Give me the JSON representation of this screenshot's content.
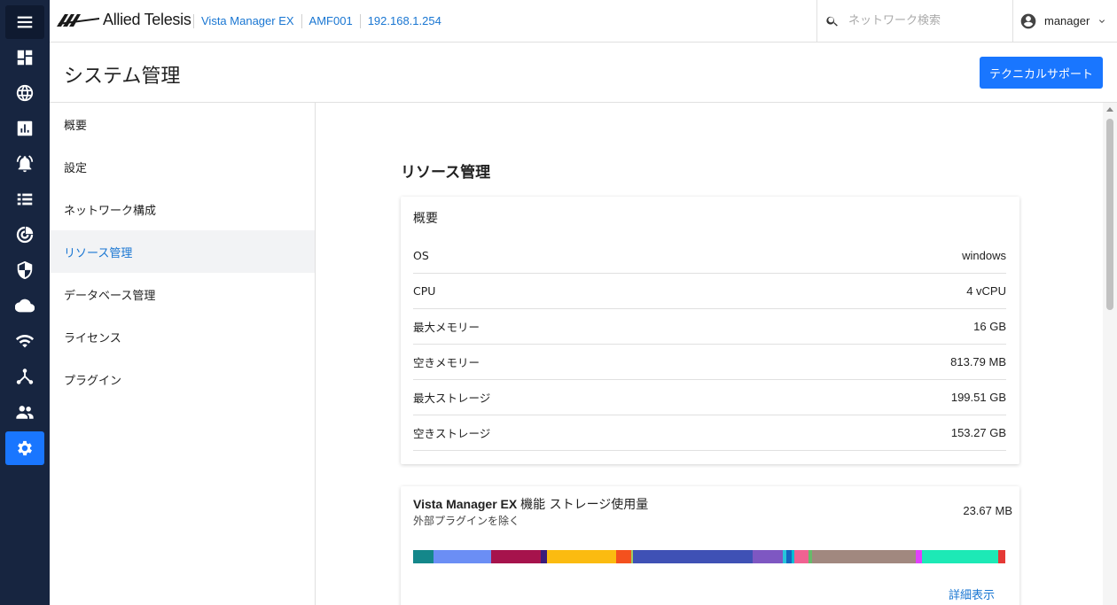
{
  "colors": {
    "rail_bg": "#172540",
    "accent": "#1976ff",
    "link": "#1976d2"
  },
  "rail": {
    "items": [
      {
        "name": "menu-icon"
      },
      {
        "name": "dashboard-icon"
      },
      {
        "name": "globe-icon"
      },
      {
        "name": "analytics-icon"
      },
      {
        "name": "alarm-bell-icon"
      },
      {
        "name": "list-icon"
      },
      {
        "name": "radar-icon"
      },
      {
        "name": "security-shield-icon"
      },
      {
        "name": "cloud-icon"
      },
      {
        "name": "wifi-icon"
      },
      {
        "name": "topology-icon"
      },
      {
        "name": "people-icon"
      },
      {
        "name": "settings-gear-icon",
        "active": true
      }
    ]
  },
  "header": {
    "brand": "Allied Telesis",
    "breadcrumbs": [
      "Vista Manager EX",
      "AMF001",
      "192.168.1.254"
    ],
    "search_placeholder": "ネットワーク検索",
    "user": "manager"
  },
  "page": {
    "title": "システム管理",
    "support_button": "テクニカルサポート"
  },
  "subnav": {
    "items": [
      "概要",
      "設定",
      "ネットワーク構成",
      "リソース管理",
      "データベース管理",
      "ライセンス",
      "プラグイン"
    ],
    "active_index": 3
  },
  "resource": {
    "section_title": "リソース管理",
    "overview": {
      "title": "概要",
      "rows": [
        {
          "label": "OS",
          "value": "windows"
        },
        {
          "label": "CPU",
          "value": "4 vCPU"
        },
        {
          "label": "最大メモリー",
          "value": "16 GB"
        },
        {
          "label": "空きメモリー",
          "value": "813.79 MB"
        },
        {
          "label": "最大ストレージ",
          "value": "199.51 GB"
        },
        {
          "label": "空きストレージ",
          "value": "153.27 GB"
        }
      ]
    },
    "storage": {
      "title_en": "Vista Manager EX",
      "title_jp": "機能 ストレージ使用量",
      "subtitle": "外部プラグインを除く",
      "total": "23.67 MB",
      "segments": [
        {
          "color": "#14878a",
          "share": 3.5
        },
        {
          "color": "#6b8ef5",
          "share": 9.6
        },
        {
          "color": "#a6134c",
          "share": 8.4
        },
        {
          "color": "#3a1b7a",
          "share": 1.1
        },
        {
          "color": "#fbbb10",
          "share": 11.7
        },
        {
          "color": "#f4511e",
          "share": 2.5
        },
        {
          "color": "#9ccc65",
          "share": 0.3
        },
        {
          "color": "#3f51b5",
          "share": 20.2
        },
        {
          "color": "#7e57c2",
          "share": 5.1
        },
        {
          "color": "#26c6da",
          "share": 0.7
        },
        {
          "color": "#1565c0",
          "share": 0.9
        },
        {
          "color": "#00bcd4",
          "share": 0.4
        },
        {
          "color": "#f06292",
          "share": 2.4
        },
        {
          "color": "#66bb6a",
          "share": 0.6
        },
        {
          "color": "#a1887f",
          "share": 17.5
        },
        {
          "color": "#e040fb",
          "share": 1.0
        },
        {
          "color": "#1de9b6",
          "share": 12.9
        },
        {
          "color": "#e53935",
          "share": 1.2
        }
      ],
      "detail_link": "詳細表示"
    }
  }
}
